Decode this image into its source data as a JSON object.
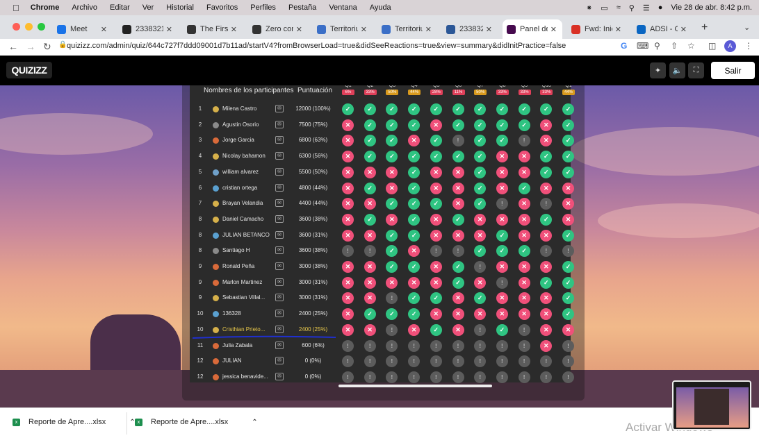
{
  "macbar": {
    "app": "Chrome",
    "menus": [
      "Archivo",
      "Editar",
      "Ver",
      "Historial",
      "Favoritos",
      "Perfiles",
      "Pestaña",
      "Ventana",
      "Ayuda"
    ],
    "datetime": "Vie 28 de abr.  8:42 p.m."
  },
  "tabs": [
    {
      "title": "Meet",
      "color": "#1a73e8"
    },
    {
      "title": "2338321_",
      "color": "#222222"
    },
    {
      "title": "The First C",
      "color": "#333333"
    },
    {
      "title": "Zero cond",
      "color": "#333333"
    },
    {
      "title": "Territorium",
      "color": "#3b6fc7"
    },
    {
      "title": "Territorium",
      "color": "#3b6fc7"
    },
    {
      "title": "2338321_",
      "color": "#2b5797"
    },
    {
      "title": "Panel de c",
      "color": "#460a4e"
    },
    {
      "title": "Fwd: Inici",
      "color": "#d93025"
    },
    {
      "title": "ADSI - Or",
      "color": "#0a66c2"
    }
  ],
  "address": "quizizz.com/admin/quiz/644c727f7ddd09001d7b11ad/startV4?fromBrowserLoad=true&didSeeReactions=true&view=summary&didInitPractice=false",
  "profile_initial": "A",
  "quizizz": {
    "logo": "QUIZIZZ",
    "exit_label": "Salir"
  },
  "table": {
    "col_participants": "Nombres de los participantes",
    "col_score": "Puntuación",
    "questions": [
      {
        "label": "Q1",
        "pct": "6%",
        "color": "#e0405a"
      },
      {
        "label": "Q2",
        "pct": "33%",
        "color": "#e0405a"
      },
      {
        "label": "Q3",
        "pct": "50%",
        "color": "#d99a1e"
      },
      {
        "label": "Q4",
        "pct": "44%",
        "color": "#d99a1e"
      },
      {
        "label": "Q5",
        "pct": "28%",
        "color": "#e0405a"
      },
      {
        "label": "Q6",
        "pct": "11%",
        "color": "#e0405a"
      },
      {
        "label": "Q7",
        "pct": "50%",
        "color": "#d99a1e"
      },
      {
        "label": "Q8",
        "pct": "33%",
        "color": "#e0405a"
      },
      {
        "label": "Q9",
        "pct": "33%",
        "color": "#e0405a"
      },
      {
        "label": "Q10",
        "pct": "33%",
        "color": "#e0405a"
      },
      {
        "label": "Q1",
        "pct": "44%",
        "color": "#d99a1e"
      }
    ],
    "rows": [
      {
        "rank": "1",
        "name": "Milena Castro",
        "score": "12000 (100%)",
        "avatar": "#d6b04a",
        "answers": "ccccccccccc"
      },
      {
        "rank": "2",
        "name": "Agustin Osorio",
        "score": "7500 (75%)",
        "avatar": "#8a8a8a",
        "answers": "wcccwccccwc"
      },
      {
        "rank": "3",
        "name": "Jorge Garcia",
        "score": "6800 (63%)",
        "avatar": "#d96a3a",
        "answers": "wccwcuccuwc"
      },
      {
        "rank": "4",
        "name": "Nicolay bahamon",
        "score": "6300 (56%)",
        "avatar": "#d6b04a",
        "answers": "wccccccwwcc"
      },
      {
        "rank": "5",
        "name": "william alvarez",
        "score": "5500 (50%)",
        "avatar": "#6fa0c9",
        "answers": "wwwcwwcwwcc"
      },
      {
        "rank": "6",
        "name": "cristian ortega",
        "score": "4800 (44%)",
        "avatar": "#5aa0d0",
        "answers": "wcwcwwcwcww"
      },
      {
        "rank": "7",
        "name": "Brayan Velandia",
        "score": "4400 (44%)",
        "avatar": "#d6b04a",
        "answers": "wwcccwcuwuw"
      },
      {
        "rank": "8",
        "name": "Daniel Camacho",
        "score": "3600 (38%)",
        "avatar": "#d6b04a",
        "answers": "wcwcwcwwwcw"
      },
      {
        "rank": "8",
        "name": "JULIAN BETANCOUR...",
        "score": "3600 (31%)",
        "avatar": "#5aa0d0",
        "answers": "wwccwwwcwwc"
      },
      {
        "rank": "8",
        "name": "Santiago H",
        "score": "3600 (38%)",
        "avatar": "#8a8a8a",
        "answers": "uucwuucccuu"
      },
      {
        "rank": "9",
        "name": "Ronald Peña",
        "score": "3000 (38%)",
        "avatar": "#d96a3a",
        "answers": "wwccwcuwwwc"
      },
      {
        "rank": "9",
        "name": "Marlon Martinez",
        "score": "3000 (31%)",
        "avatar": "#d96a3a",
        "answers": "wwwwwcwuwcc"
      },
      {
        "rank": "9",
        "name": "Sebastian Villal...",
        "score": "3000 (31%)",
        "avatar": "#d6b04a",
        "answers": "wwuccwcwwwc"
      },
      {
        "rank": "10",
        "name": "136328",
        "score": "2400 (25%)",
        "avatar": "#5aa0d0",
        "answers": "wcccwwwwwwc"
      },
      {
        "rank": "10",
        "name": "Cristhian Prieto...",
        "score": "2400 (25%)",
        "avatar": "#d6b04a",
        "answers": "wwuwcwucuww",
        "highlight": true
      },
      {
        "rank": "11",
        "name": "Julia Zabala",
        "score": "600 (6%)",
        "avatar": "#d96a3a",
        "answers": "uuuuuuuuuwu"
      },
      {
        "rank": "12",
        "name": "JULIAN",
        "score": "0 (0%)",
        "avatar": "#d96a3a",
        "answers": "uuuuuuuuuuu"
      },
      {
        "rank": "12",
        "name": "jessica benavide...",
        "score": "0 (0%)",
        "avatar": "#d96a3a",
        "answers": "uuuuuuuuuuu"
      }
    ]
  },
  "downloads": [
    {
      "name": "Reporte de Apre....xlsx"
    },
    {
      "name": "Reporte de Apre....xlsx"
    }
  ],
  "watermark": "Activar Windows"
}
